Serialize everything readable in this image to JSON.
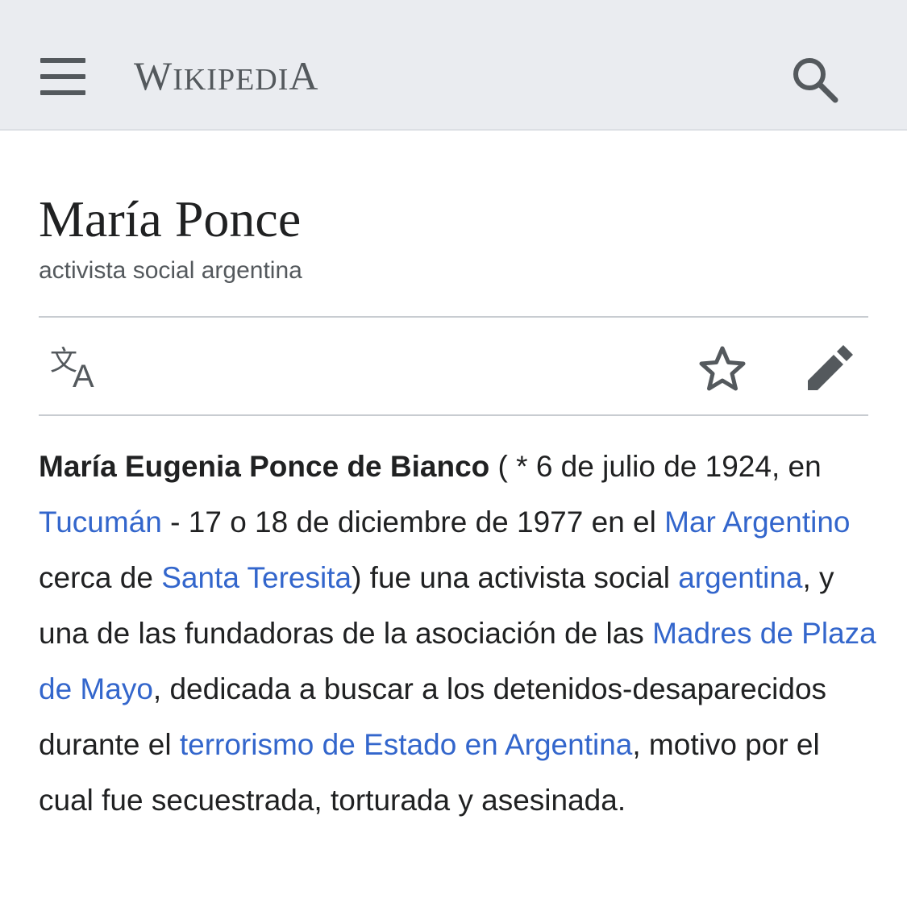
{
  "header": {
    "menu_icon": "hamburger-menu-icon",
    "wordmark_W": "W",
    "wordmark_ikipedi": "IKIPEDI",
    "wordmark_A": "A",
    "search_icon": "search-icon",
    "background_color": "#eaecf0"
  },
  "page": {
    "title": "María Ponce",
    "subtitle": "activista social argentina"
  },
  "actions": {
    "language_icon": "translate-icon",
    "language_glyph_zh": "文",
    "language_glyph_a": "A",
    "watch_icon": "star-icon",
    "edit_icon": "pencil-icon"
  },
  "article": {
    "p1_bold": "María Eugenia Ponce de Bianco",
    "p1_t1": " ( * 6 de julio de 1924, en ",
    "p1_l1": "Tucumán",
    "p1_t2": " - 17 o 18 de diciembre de 1977 en el ",
    "p1_l2": "Mar Argentino",
    "p1_t3": " cerca de ",
    "p1_l3": "Santa Teresita",
    "p1_t4": ") fue una activista social ",
    "p1_l4": "argentina",
    "p1_t5": ", y una de las fundadoras de la asociación de las ",
    "p1_l5": "Madres de Plaza de Mayo",
    "p1_t6": ", dedicada a buscar a los detenidos-desaparecidos durante el ",
    "p1_l6": "terrorismo de Estado en Argentina",
    "p1_t7": ", motivo por el cual fue secuestrada, torturada y asesinada."
  },
  "colors": {
    "link": "#3366cc",
    "text": "#202122",
    "icon": "#54595d"
  }
}
